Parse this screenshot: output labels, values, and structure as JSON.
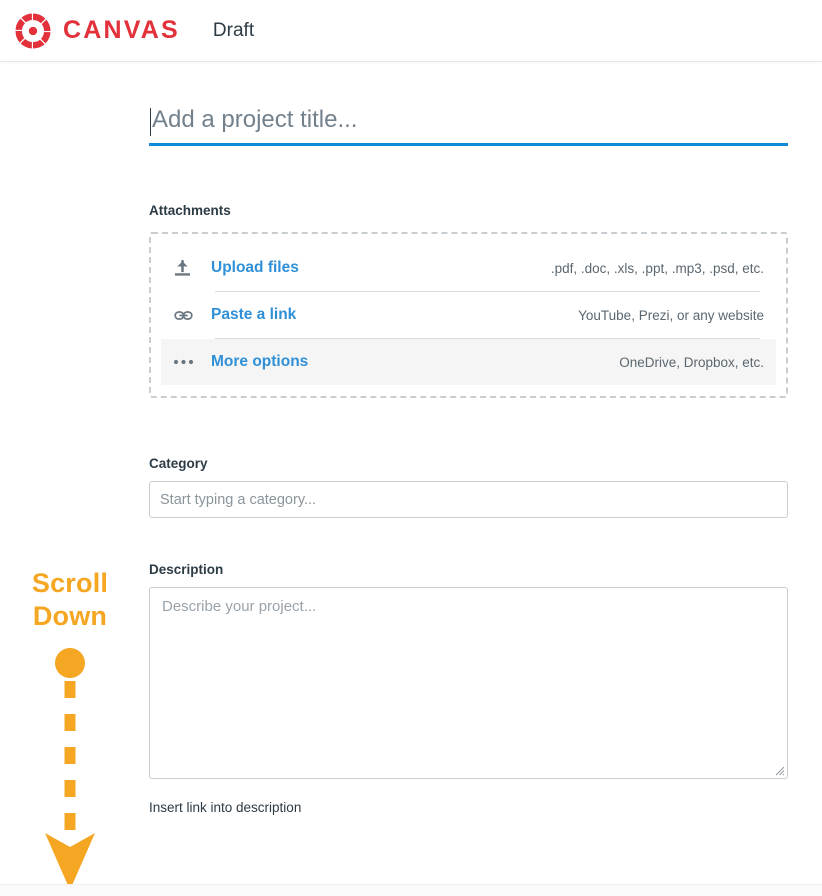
{
  "header": {
    "logo_icon": "canvas-logo-icon",
    "brand": "CANVAS",
    "title": "Draft"
  },
  "form": {
    "title_field": {
      "placeholder": "Add a project title...",
      "value": "",
      "caret_visible": true,
      "underline_color": "#0e8ad8"
    },
    "attachments": {
      "label": "Attachments",
      "rows": [
        {
          "icon": "upload-icon",
          "link": "Upload files",
          "hint": ".pdf, .doc, .xls, .ppt, .mp3, .psd, etc.",
          "highlighted": false
        },
        {
          "icon": "link-icon",
          "link": "Paste a link",
          "hint": "YouTube, Prezi, or any website",
          "highlighted": false
        },
        {
          "icon": "ellipsis-icon",
          "link": "More options",
          "hint": "OneDrive, Dropbox, etc.",
          "highlighted": true
        }
      ]
    },
    "category": {
      "label": "Category",
      "placeholder": "Start typing a category...",
      "value": ""
    },
    "description": {
      "label": "Description",
      "placeholder": "Describe your project...",
      "value": "",
      "footer_text": "Insert link into description"
    }
  },
  "annotation": {
    "line1": "Scroll",
    "line2": "Down",
    "color": "#f5a623",
    "arrow_icon": "scroll-down-arrow-icon"
  },
  "colors": {
    "brand_red": "#e2313a",
    "link_blue": "#2f90d8",
    "accent_orange": "#f5a623",
    "text_dark": "#2d3b45",
    "border_gray": "#c7cdd1"
  }
}
